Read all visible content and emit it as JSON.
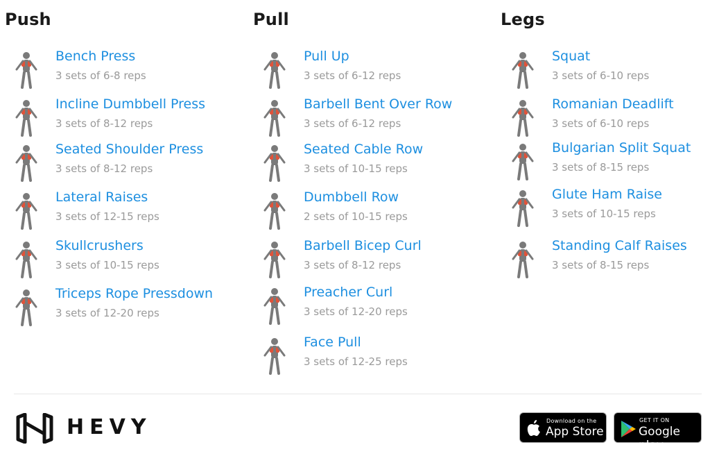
{
  "columns": [
    {
      "title": "Push",
      "exercises": [
        {
          "name": "Bench Press",
          "sets": "3 sets of 6-8 reps",
          "icon": "bench-press-figure-icon"
        },
        {
          "name": "Incline Dumbbell Press",
          "sets": "3 sets of 8-12 reps",
          "icon": "incline-dumbbell-press-figure-icon"
        },
        {
          "name": "Seated Shoulder Press",
          "sets": "3 sets of 8-12 reps",
          "icon": "seated-shoulder-press-figure-icon"
        },
        {
          "name": "Lateral Raises",
          "sets": "3 sets of 12-15 reps",
          "icon": "lateral-raises-figure-icon"
        },
        {
          "name": "Skullcrushers",
          "sets": "3 sets of 10-15 reps",
          "icon": "skullcrushers-figure-icon"
        },
        {
          "name": "Triceps Rope Pressdown",
          "sets": "3 sets of 12-20 reps",
          "icon": "triceps-rope-pressdown-figure-icon"
        }
      ]
    },
    {
      "title": "Pull",
      "exercises": [
        {
          "name": "Pull Up",
          "sets": "3 sets of 6-12 reps",
          "icon": "pull-up-figure-icon"
        },
        {
          "name": "Barbell Bent Over Row",
          "sets": "3 sets of 6-12 reps",
          "icon": "barbell-row-figure-icon"
        },
        {
          "name": "Seated Cable Row",
          "sets": "3 sets of 10-15 reps",
          "icon": "seated-cable-row-figure-icon"
        },
        {
          "name": "Dumbbell Row",
          "sets": "2 sets of 10-15 reps",
          "icon": "dumbbell-row-figure-icon"
        },
        {
          "name": "Barbell Bicep Curl",
          "sets": "3 sets of 8-12 reps",
          "icon": "barbell-curl-figure-icon"
        },
        {
          "name": "Preacher Curl",
          "sets": "3 sets of 12-20 reps",
          "icon": "preacher-curl-figure-icon"
        },
        {
          "name": "Face Pull",
          "sets": "3 sets of 12-25 reps",
          "icon": "face-pull-figure-icon"
        }
      ]
    },
    {
      "title": "Legs",
      "exercises": [
        {
          "name": "Squat",
          "sets": "3 sets of 6-10 reps",
          "icon": "squat-figure-icon"
        },
        {
          "name": "Romanian Deadlift",
          "sets": "3 sets of 6-10 reps",
          "icon": "romanian-deadlift-figure-icon"
        },
        {
          "name": "Bulgarian Split Squat",
          "sets": "3 sets of 8-15 reps",
          "icon": "bulgarian-split-squat-figure-icon"
        },
        {
          "name": "Glute Ham Raise",
          "sets": "3 sets of 10-15 reps",
          "icon": "glute-ham-raise-figure-icon"
        },
        {
          "name": "Standing Calf Raises",
          "sets": "3 sets of 8-15 reps",
          "icon": "standing-calf-raises-figure-icon"
        }
      ]
    }
  ],
  "footer": {
    "brand": "HEVY",
    "app_store": {
      "small": "Download on the",
      "big": "App Store",
      "icon": "apple-icon"
    },
    "google_play": {
      "small": "GET IT ON",
      "big": "Google play",
      "icon": "google-play-icon"
    }
  },
  "colors": {
    "link": "#1d8fe0",
    "sub": "#9a9a9a",
    "muscle": "#e0533a",
    "figure": "#7a7a7a"
  }
}
